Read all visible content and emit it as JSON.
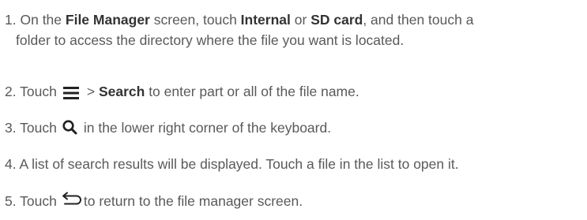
{
  "steps": [
    {
      "number": "1.",
      "parts": [
        "On the ",
        "File Manager",
        " screen, touch ",
        "Internal",
        " or ",
        "SD card",
        ", and then touch a"
      ],
      "line2": "folder to access the directory where the file you want is located."
    },
    {
      "number": "2.",
      "parts": [
        "Touch",
        "> ",
        "Search",
        " to enter part or all of the file name."
      ],
      "icon": "menu-icon"
    },
    {
      "number": "3.",
      "parts": [
        "Touch",
        "in the lower right corner of the keyboard."
      ],
      "icon": "search-icon"
    },
    {
      "number": "4.",
      "parts": [
        "A list of search results will be displayed. Touch a file in the list to open it."
      ]
    },
    {
      "number": "5.",
      "parts": [
        "Touch",
        "to return to the file manager screen."
      ],
      "icon": "back-icon"
    }
  ],
  "colors": {
    "text": "#595959",
    "bold": "#333333",
    "icon": "#222222"
  }
}
